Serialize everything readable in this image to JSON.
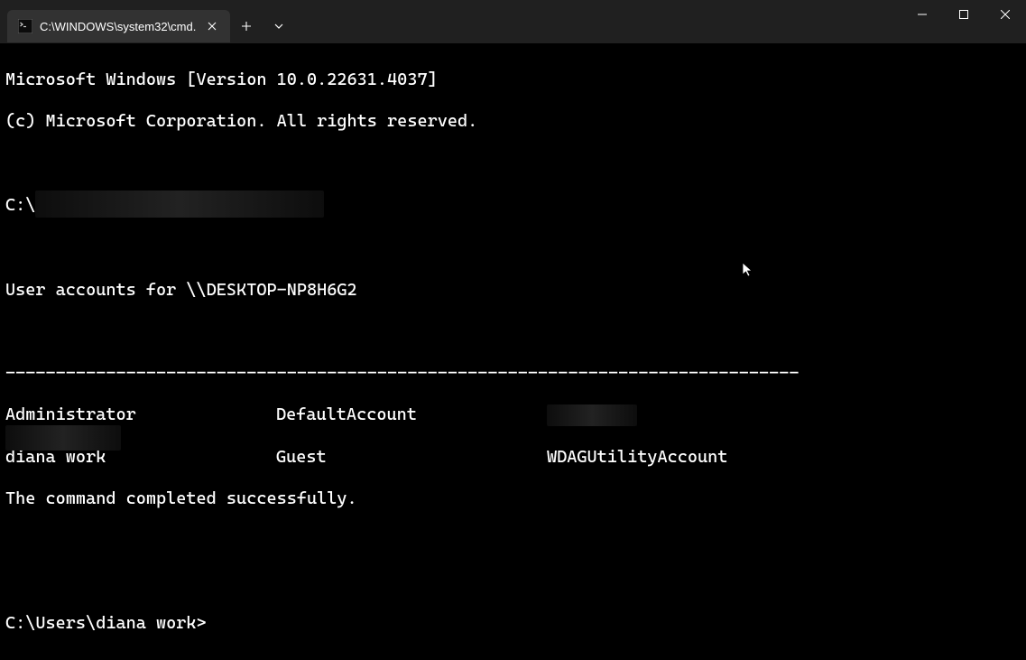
{
  "titlebar": {
    "tab_title": "C:\\WINDOWS\\system32\\cmd."
  },
  "terminal": {
    "banner1": "Microsoft Windows [Version 10.0.22631.4037]",
    "banner2": "(c) Microsoft Corporation. All rights reserved.",
    "prompt1_prefix": "C:\\",
    "accounts_header": "User accounts for \\\\DESKTOP-NP8H6G2",
    "separator": "-------------------------------------------------------------------------------",
    "row1_c1": "Administrator",
    "row1_c2": "DefaultAccount",
    "row2_c1": "diana work",
    "row2_c2": "Guest",
    "row2_c3": "WDAGUtilityAccount",
    "completed": "The command completed successfully.",
    "prompt2": "C:\\Users\\diana work>"
  }
}
